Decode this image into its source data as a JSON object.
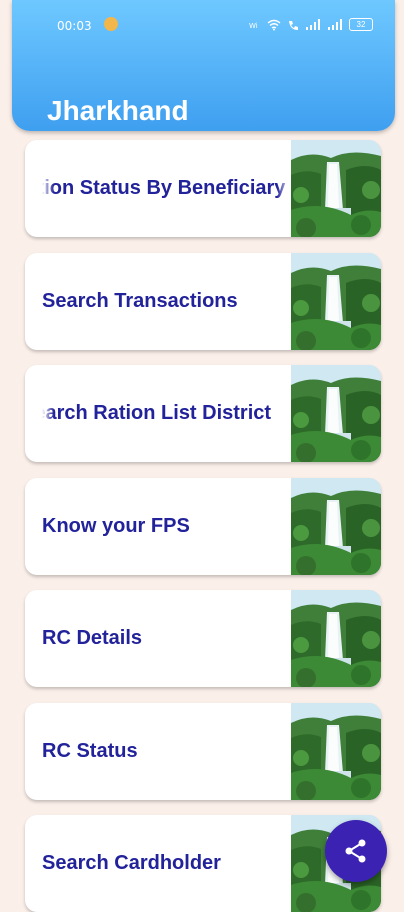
{
  "status_bar": {
    "time": "00:03",
    "icons": [
      "vowifi-icon",
      "wifi-icon",
      "call-icon",
      "signal-icon",
      "signal-icon"
    ],
    "battery": "32"
  },
  "header": {
    "title": "Jharkhand",
    "color_top": "#6ec8ff",
    "color_bottom": "#3f9ff0"
  },
  "menu": {
    "items": [
      {
        "label": "Ration Status By Beneficiary",
        "icon": "waterfall-image"
      },
      {
        "label": "Search Transactions",
        "icon": "waterfall-image"
      },
      {
        "label": "Search Ration List District",
        "icon": "waterfall-image"
      },
      {
        "label": "Know your FPS",
        "icon": "waterfall-image"
      },
      {
        "label": "RC Details",
        "icon": "waterfall-image"
      },
      {
        "label": "RC Status",
        "icon": "waterfall-image"
      },
      {
        "label": "Search Cardholder",
        "icon": "waterfall-image"
      }
    ]
  },
  "fab": {
    "icon": "share-icon",
    "color": "#3b22b3"
  },
  "colors": {
    "background": "#fbefe9",
    "label": "#22229a"
  }
}
